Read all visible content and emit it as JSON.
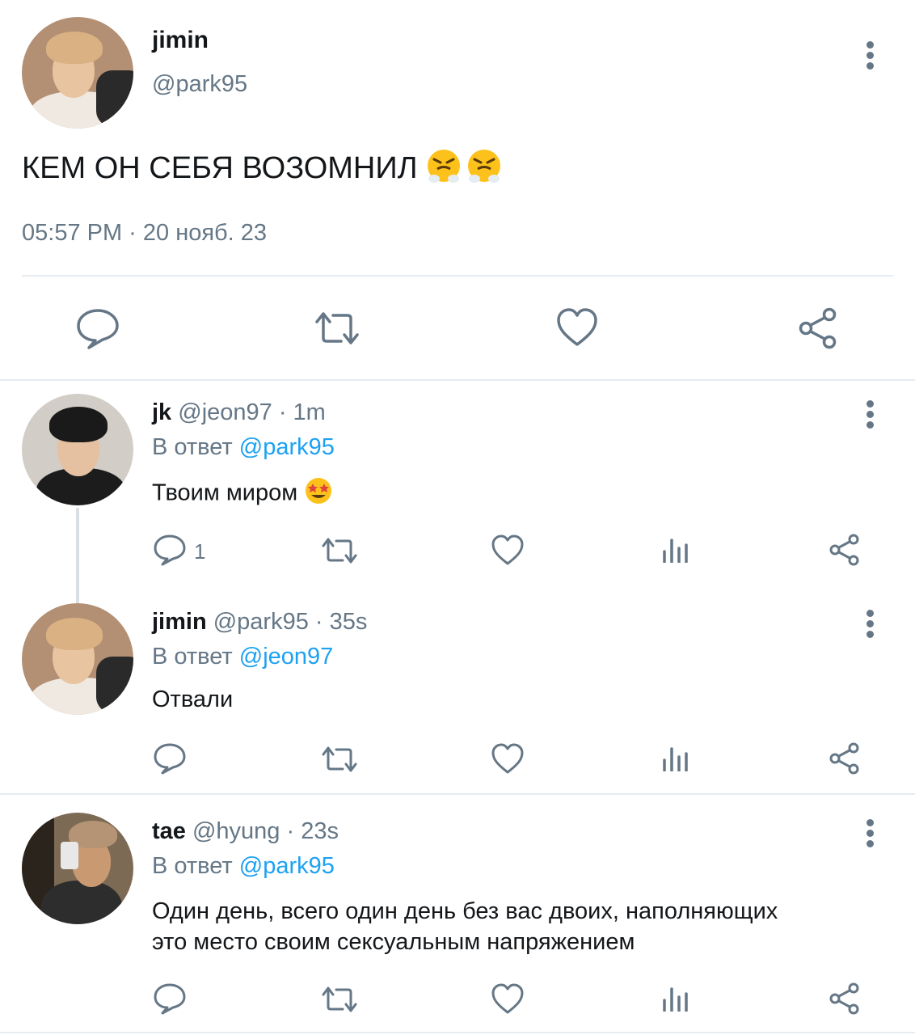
{
  "main_tweet": {
    "display_name": "jimin",
    "handle": "@park95",
    "text": "КЕМ ОН СЕБЯ ВОЗОМНИЛ",
    "text_emoji": "face-with-steam-from-nose",
    "timestamp": "05:57 PM · 20 нояб. 23",
    "actions": [
      "reply-icon",
      "retweet-icon",
      "like-icon",
      "share-icon"
    ]
  },
  "replies": [
    {
      "display_name": "jk",
      "handle": "@jeon97",
      "time": "· 1m",
      "reply_prefix": "В ответ",
      "reply_to": "@park95",
      "text": "Твоим миром",
      "text_emoji": "star-struck-face",
      "reply_count": "1"
    },
    {
      "display_name": "jimin",
      "handle": "@park95",
      "time": "· 35s",
      "reply_prefix": "В ответ",
      "reply_to": "@jeon97",
      "text": "Отвали",
      "reply_count": ""
    },
    {
      "display_name": "tae",
      "handle": "@hyung",
      "time": "· 23s",
      "reply_prefix": "В ответ",
      "reply_to": "@park95",
      "text_line1": "Один день, всего один день без вас двоих, наполняющих",
      "text_line2": "это место своим сексуальным напряжением",
      "reply_count": ""
    }
  ],
  "colors": {
    "text": "#14171a",
    "muted": "#657786",
    "link": "#1da1f2",
    "divider": "#e6ecf0"
  }
}
